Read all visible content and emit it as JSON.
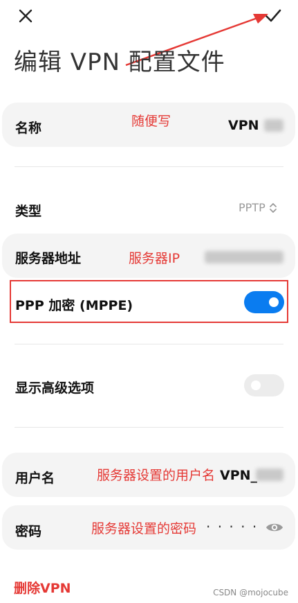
{
  "header": {
    "title": "编辑 VPN 配置文件",
    "close_icon": "close-icon",
    "confirm_icon": "check-icon"
  },
  "fields": {
    "name": {
      "label": "名称",
      "value": "VPN ",
      "annotation": "随便写"
    },
    "type": {
      "label": "类型",
      "value": "PPTP"
    },
    "server": {
      "label": "服务器地址",
      "annotation": "服务器IP"
    },
    "mppe": {
      "label": "PPP 加密 (MPPE)",
      "enabled": true
    },
    "advanced": {
      "label": "显示高级选项",
      "enabled": false
    },
    "username": {
      "label": "用户名",
      "value": "VPN_",
      "annotation": "服务器设置的用户名"
    },
    "password": {
      "label": "密码",
      "value": "· · · · ·",
      "annotation": "服务器设置的密码"
    }
  },
  "delete_label": "删除VPN",
  "watermark": "CSDN @mojocube",
  "colors": {
    "accent": "#0a7cf0",
    "annotation": "#e53935"
  }
}
